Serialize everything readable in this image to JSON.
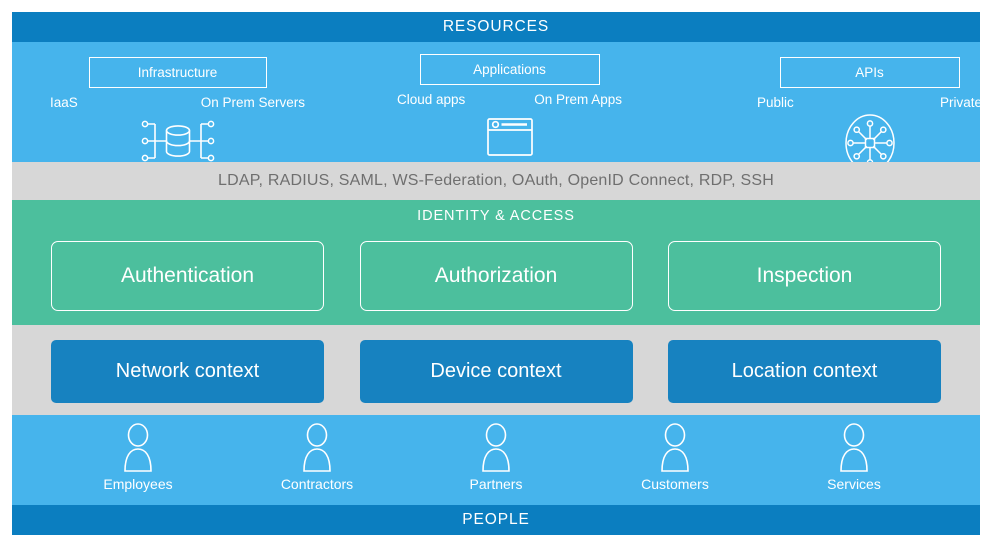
{
  "resources": {
    "header_title": "RESOURCES",
    "columns": [
      {
        "id": "infrastructure",
        "box_label": "Infrastructure",
        "sublabels": [
          "IaaS",
          "On Prem Servers"
        ],
        "icon": "database-server-icon"
      },
      {
        "id": "applications",
        "box_label": "Applications",
        "sublabels": [
          "Cloud apps",
          "On Prem Apps"
        ],
        "icon": "browser-window-icon"
      },
      {
        "id": "apis",
        "box_label": "APIs",
        "sublabels": [
          "Public",
          "Private"
        ],
        "icon": "api-network-hub-icon"
      }
    ]
  },
  "protocols": {
    "text": "LDAP, RADIUS, SAML, WS-Federation, OAuth, OpenID Connect, RDP, SSH"
  },
  "identity": {
    "title": "IDENTITY & ACCESS",
    "cards": [
      {
        "label": "Authentication"
      },
      {
        "label": "Authorization"
      },
      {
        "label": "Inspection"
      }
    ]
  },
  "context": {
    "cards": [
      {
        "label": "Network context"
      },
      {
        "label": "Device context"
      },
      {
        "label": "Location context"
      }
    ]
  },
  "people": {
    "footer_title": "PEOPLE",
    "personas": [
      {
        "label": "Employees",
        "icon": "person-icon"
      },
      {
        "label": "Contractors",
        "icon": "person-icon"
      },
      {
        "label": "Partners",
        "icon": "person-icon"
      },
      {
        "label": "Customers",
        "icon": "person-icon"
      },
      {
        "label": "Services",
        "icon": "person-icon"
      }
    ]
  },
  "colors": {
    "header_blue": "#0b7ec0",
    "band_blue": "#46b4ec",
    "gray": "#d7d7d7",
    "green": "#4cbf9d",
    "context_blue": "#1782c0",
    "protocol_text": "#6f6f6f",
    "white": "#ffffff"
  }
}
